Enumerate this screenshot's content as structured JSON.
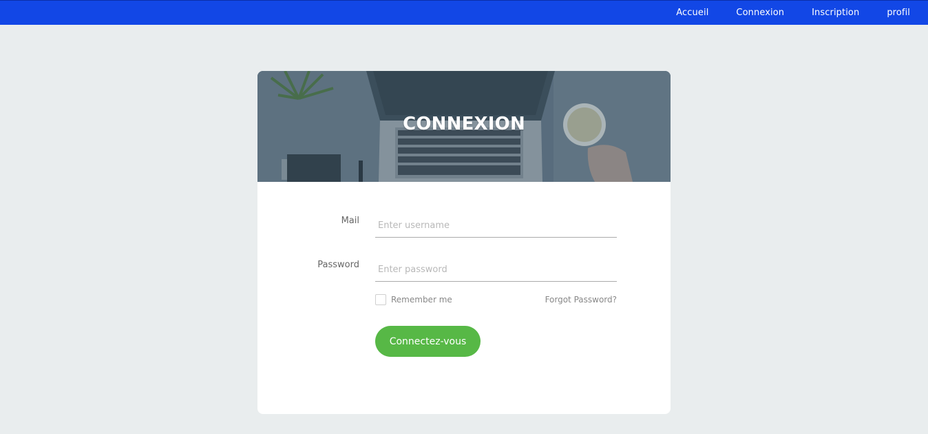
{
  "nav": {
    "items": [
      "Accueil",
      "Connexion",
      "Inscription",
      "profil"
    ]
  },
  "hero": {
    "title": "CONNEXION"
  },
  "form": {
    "mail_label": "Mail",
    "mail_placeholder": "Enter username",
    "password_label": "Password",
    "password_placeholder": "Enter password",
    "remember_label": "Remember me",
    "forgot_label": "Forgot Password?",
    "submit_label": "Connectez-vous"
  },
  "colors": {
    "nav_bg": "#1247e6",
    "page_bg": "#e9edee",
    "button_bg": "#57b846"
  }
}
